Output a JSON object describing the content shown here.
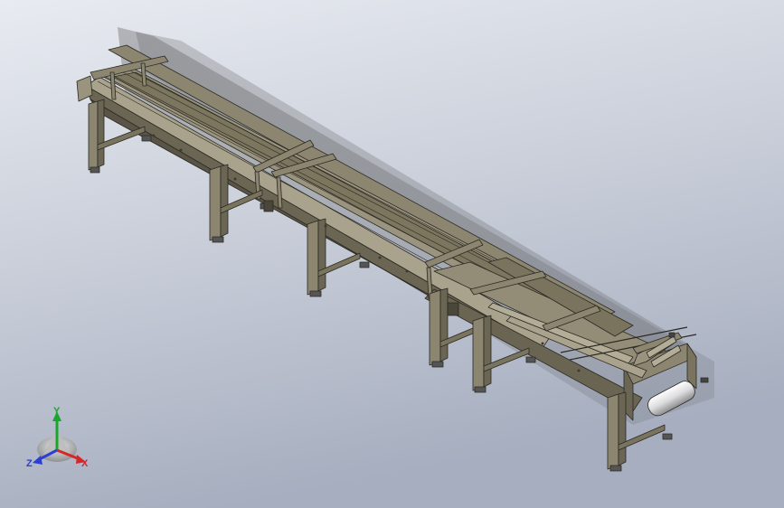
{
  "viewport": {
    "background_top": "#e3e7ef",
    "background_bottom": "#aab1c2",
    "model_color": "#8c8570",
    "model_shade": "#6b6553",
    "model_light": "#b3ac96",
    "outline_color": "#2a2a24",
    "roller_color": "#e8e8ea"
  },
  "triad": {
    "y_label": "Y",
    "x_label": "X",
    "z_label": "Z",
    "y_color": "#1aa62b",
    "x_color": "#d6262a",
    "z_color": "#2b3fd1"
  }
}
